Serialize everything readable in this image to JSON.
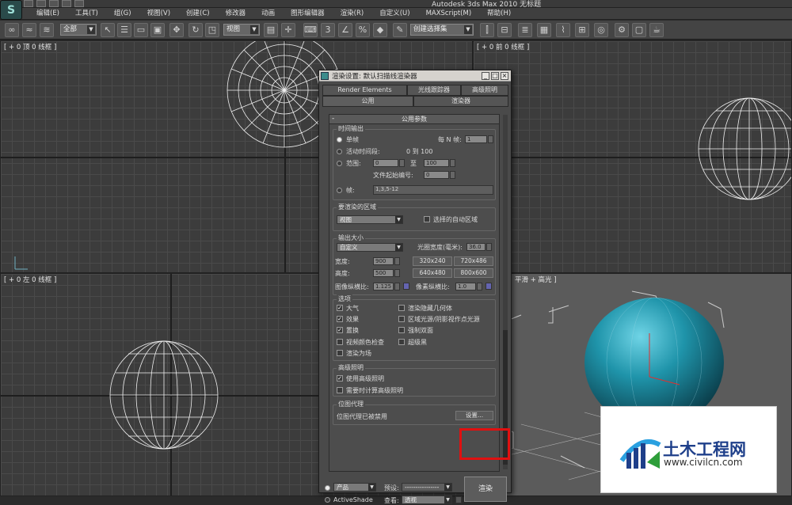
{
  "window": {
    "title": "Autodesk 3ds Max  2010   无标题"
  },
  "menu": [
    "编辑(E)",
    "工具(T)",
    "组(G)",
    "视图(V)",
    "创建(C)",
    "修改器",
    "动画",
    "图形编辑器",
    "渲染(R)",
    "自定义(U)",
    "MAXScript(M)",
    "帮助(H)"
  ],
  "toolbar": {
    "filter_select": "全部",
    "coord_select": "视图",
    "named_selection": "创建选择集"
  },
  "viewports": {
    "top": "[ + 0 顶 0 线框 ]",
    "front": "[ + 0 前 0 线框 ]",
    "left": "[ + 0 左 0 线框 ]",
    "persp": "平滑 + 高光 ]"
  },
  "dialog": {
    "title": "渲染设置: 默认扫描线渲染器",
    "tabs_row1": [
      "Render Elements",
      "光线跟踪器",
      "高级照明"
    ],
    "tabs_row2": [
      "公用",
      "渲染器"
    ],
    "rollout_title": "公用参数",
    "time_output": {
      "label": "时间输出",
      "single": "单帧",
      "every_nth_label": "每 N 帧:",
      "every_nth_value": "1",
      "active_segment": "活动时间段:",
      "active_range": "0 到 100",
      "range_label": "范围:",
      "range_from": "0",
      "range_to_label": "至",
      "range_to": "100",
      "file_number_label": "文件起始编号:",
      "file_number": "0",
      "frames_label": "帧:",
      "frames_value": "1,3,5-12"
    },
    "area": {
      "label": "要渲染的区域",
      "value": "视图",
      "auto_region": "选择的自动区域"
    },
    "output_size": {
      "label": "输出大小",
      "preset": "自定义",
      "aperture_label": "光圈宽度(毫米):",
      "aperture_value": "36.0",
      "width_label": "宽度:",
      "width": "900",
      "height_label": "高度:",
      "height": "500",
      "presets": [
        "320x240",
        "720x486",
        "640x480",
        "800x600"
      ],
      "image_aspect_label": "图像纵横比:",
      "image_aspect": "1.125",
      "pixel_aspect_label": "像素纵横比:",
      "pixel_aspect": "1.0"
    },
    "options": {
      "label": "选项",
      "items": [
        {
          "label": "大气",
          "checked": true
        },
        {
          "label": "渲染隐藏几何体",
          "checked": false
        },
        {
          "label": "效果",
          "checked": true
        },
        {
          "label": "区域光源/阴影视作点光源",
          "checked": false
        },
        {
          "label": "置换",
          "checked": true
        },
        {
          "label": "强制双面",
          "checked": false
        },
        {
          "label": "视频颜色检查",
          "checked": false
        },
        {
          "label": "超级黑",
          "checked": false
        },
        {
          "label": "渲染为场",
          "checked": false
        }
      ]
    },
    "advanced_lighting": {
      "label": "高级照明",
      "use": "使用高级照明",
      "compute": "需要时计算高级照明"
    },
    "bitmap_proxy": {
      "label": "位图代理",
      "status": "位图代理已被禁用",
      "settings_button": "设置..."
    },
    "bottom": {
      "mode1": "产品",
      "mode2": "ActiveShade",
      "preset_label": "预设:",
      "preset_value": "----------------",
      "view_label": "查看:",
      "view_value": "透视",
      "render_button": "渲染"
    }
  },
  "watermark": {
    "title": "土木工程网",
    "url": "www.civilcn.com"
  }
}
